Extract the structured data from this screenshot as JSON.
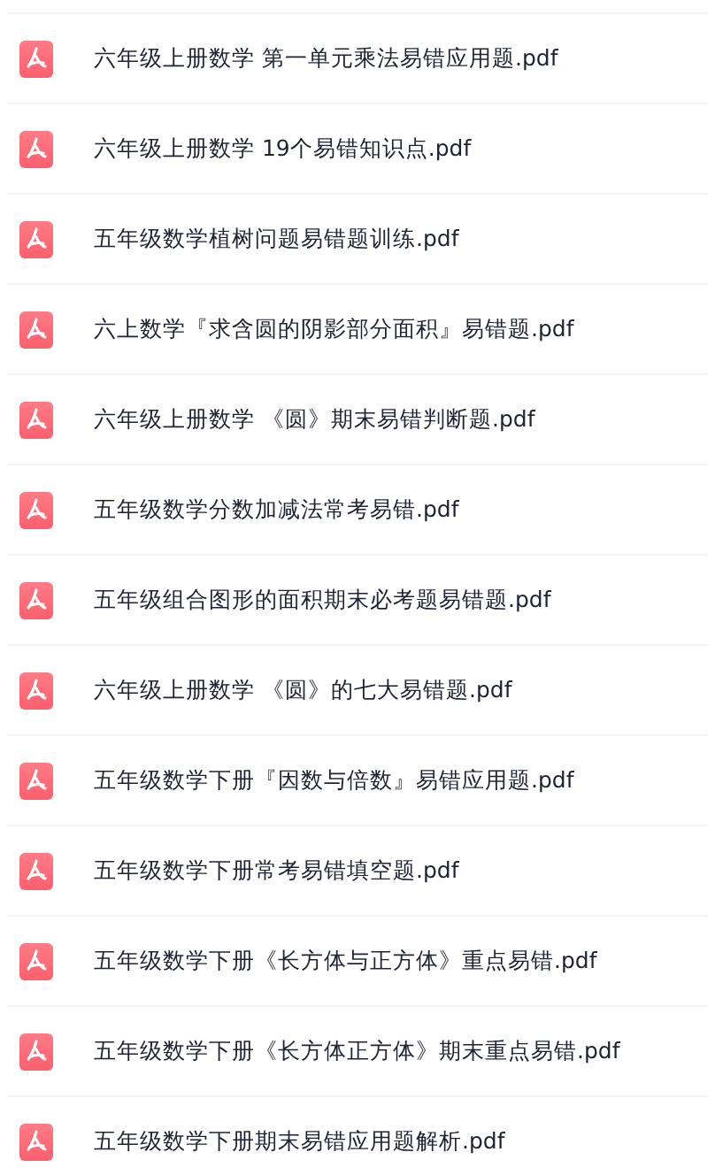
{
  "files": [
    {
      "name": "六年级上册数学 第一单元乘法易错应用题.pdf"
    },
    {
      "name": "六年级上册数学 19个易错知识点.pdf"
    },
    {
      "name": "五年级数学植树问题易错题训练.pdf"
    },
    {
      "name": "六上数学『求含圆的阴影部分面积』易错题.pdf"
    },
    {
      "name": "六年级上册数学 《圆》期末易错判断题.pdf"
    },
    {
      "name": "五年级数学分数加减法常考易错.pdf"
    },
    {
      "name": "五年级组合图形的面积期末必考题易错题.pdf"
    },
    {
      "name": "六年级上册数学 《圆》的七大易错题.pdf"
    },
    {
      "name": "五年级数学下册『因数与倍数』易错应用题.pdf"
    },
    {
      "name": "五年级数学下册常考易错填空题.pdf"
    },
    {
      "name": "五年级数学下册《长方体与正方体》重点易错.pdf"
    },
    {
      "name": "五年级数学下册《长方体正方体》期末重点易错.pdf"
    },
    {
      "name": "五年级数学下册期末易错应用题解析.pdf"
    }
  ]
}
